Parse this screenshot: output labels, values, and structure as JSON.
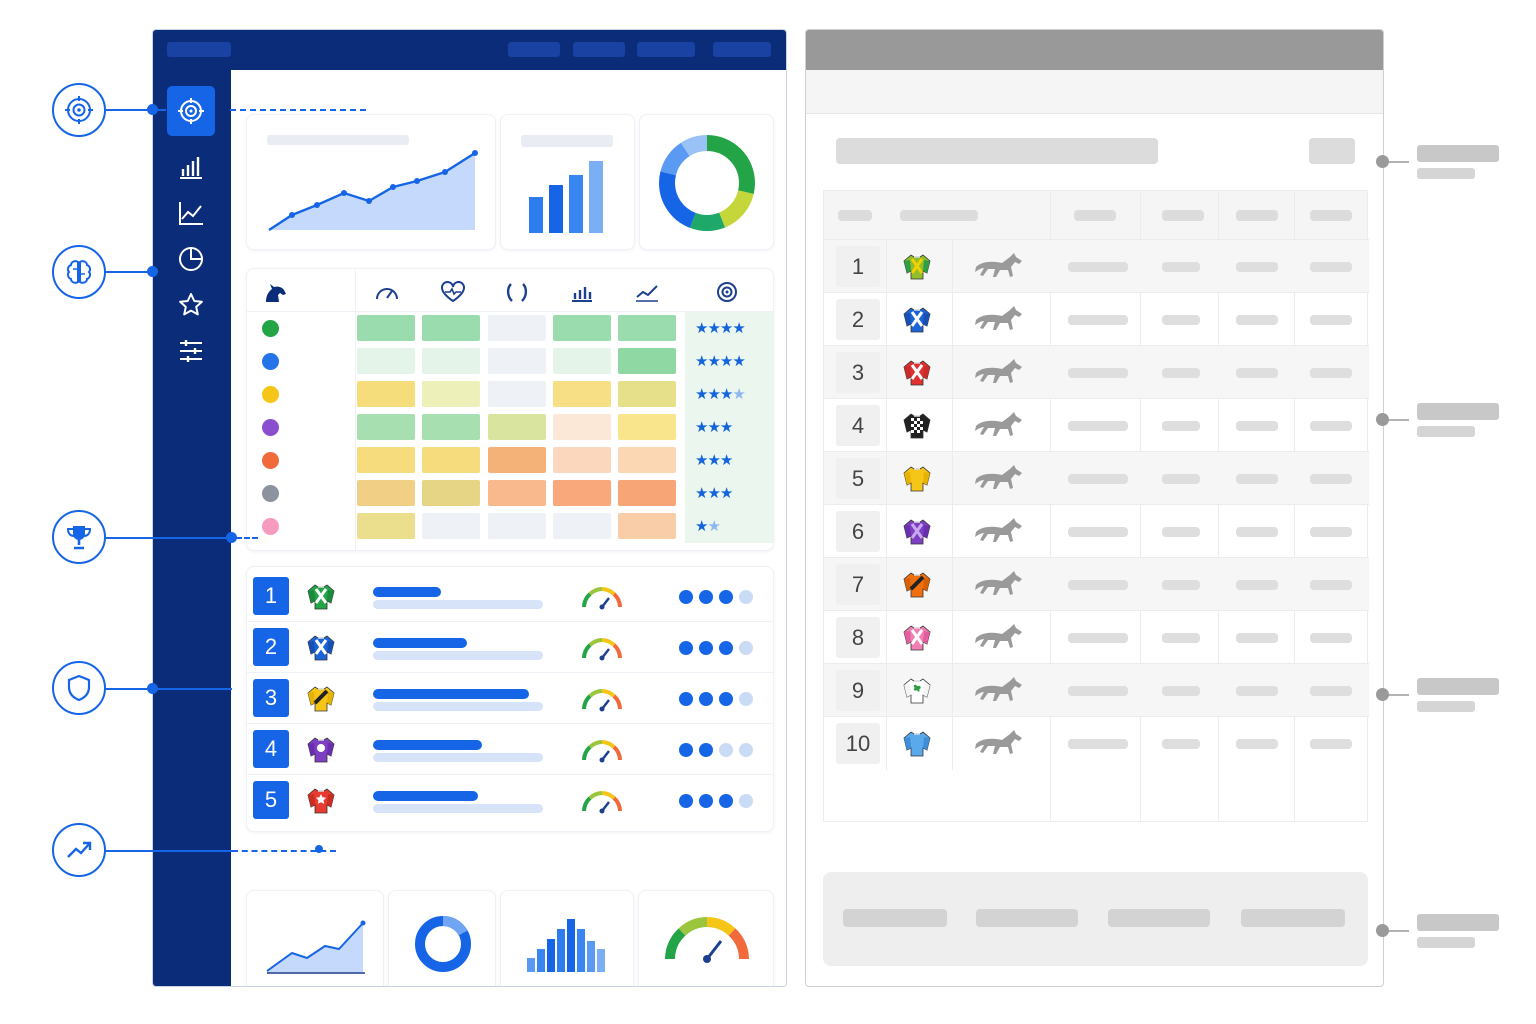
{
  "left_panel": {
    "sidebar": {
      "items": [
        {
          "icon": "target-icon",
          "active": true
        },
        {
          "icon": "bar-chart-icon",
          "active": false
        },
        {
          "icon": "line-chart-icon",
          "active": false
        },
        {
          "icon": "pie-chart-icon",
          "active": false
        },
        {
          "icon": "star-icon",
          "active": false
        },
        {
          "icon": "sliders-icon",
          "active": false
        }
      ]
    },
    "matrix": {
      "column_icons": [
        "horse-head-icon",
        "speedometer-icon",
        "heart-pulse-icon",
        "horseshoe-icon",
        "bar-chart-icon",
        "trend-line-icon",
        "target-icon"
      ],
      "rows": [
        {
          "color": "#22a447",
          "stars": 4
        },
        {
          "color": "#2575e8",
          "stars": 4
        },
        {
          "color": "#f5c518",
          "stars": 3.5
        },
        {
          "color": "#8a4fcf",
          "stars": 3
        },
        {
          "color": "#f06a3c",
          "stars": 3
        },
        {
          "color": "#8c939e",
          "stars": 3
        },
        {
          "color": "#f79ac0",
          "stars": 1.5
        }
      ]
    },
    "ranking": [
      {
        "rank": "1",
        "silk": "green-white-x",
        "progress": 0.4,
        "dots_filled": 3
      },
      {
        "rank": "2",
        "silk": "blue-white-x",
        "progress": 0.55,
        "dots_filled": 3
      },
      {
        "rank": "3",
        "silk": "yellow-black-sash",
        "progress": 0.92,
        "dots_filled": 3
      },
      {
        "rank": "4",
        "silk": "purple-white-circle",
        "progress": 0.64,
        "dots_filled": 2
      },
      {
        "rank": "5",
        "silk": "red-white-star",
        "progress": 0.62,
        "dots_filled": 3
      }
    ]
  },
  "right_panel": {
    "table_rows": [
      {
        "num": "1",
        "silk": "green-yellow"
      },
      {
        "num": "2",
        "silk": "blue-white"
      },
      {
        "num": "3",
        "silk": "red-white"
      },
      {
        "num": "4",
        "silk": "black-white-check"
      },
      {
        "num": "5",
        "silk": "yellow"
      },
      {
        "num": "6",
        "silk": "purple"
      },
      {
        "num": "7",
        "silk": "orange-black"
      },
      {
        "num": "8",
        "silk": "pink"
      },
      {
        "num": "9",
        "silk": "white-green"
      },
      {
        "num": "10",
        "silk": "light-blue"
      }
    ]
  },
  "callouts": [
    "target-icon",
    "brain-icon",
    "trophy-icon",
    "shield-icon",
    "trending-up-icon"
  ],
  "colors": {
    "navy": "#0b2c78",
    "accent": "#1565e6",
    "grey_header": "#999999"
  }
}
